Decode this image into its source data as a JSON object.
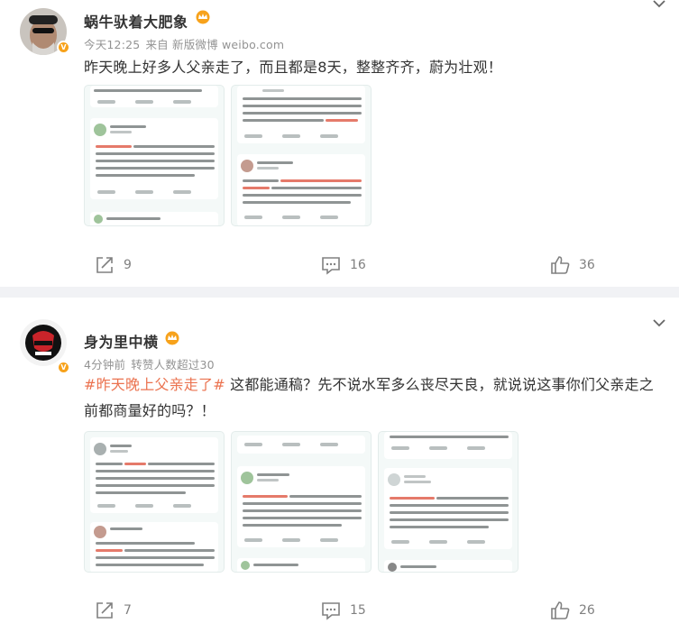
{
  "posts": [
    {
      "author": "蜗牛驮着大肥象",
      "time": "今天12:25",
      "source": "来自 新版微博 weibo.com",
      "text": "昨天晚上好多人父亲走了，而且都是8天，整整齐齐，蔚为壮观！",
      "repost_count": "9",
      "comment_count": "16",
      "like_count": "36"
    },
    {
      "author": "身为里中横",
      "time": "4分钟前",
      "source": "转赞人数超过30",
      "topic": "#昨天晚上父亲走了#",
      "text": " 这都能通稿？先不说水军多么丧尽天良，就说说这事你们父亲走之前都商量好的吗？！",
      "repost_count": "7",
      "comment_count": "15",
      "like_count": "26"
    }
  ],
  "colors": {
    "topic": "#eb7350",
    "badge": "#f7a21b",
    "meta": "#939393",
    "divider": "#f1f2f5"
  },
  "icons": [
    "chevron-down-icon",
    "verified-badge-icon",
    "crown-icon",
    "repost-icon",
    "comment-icon",
    "like-icon"
  ]
}
